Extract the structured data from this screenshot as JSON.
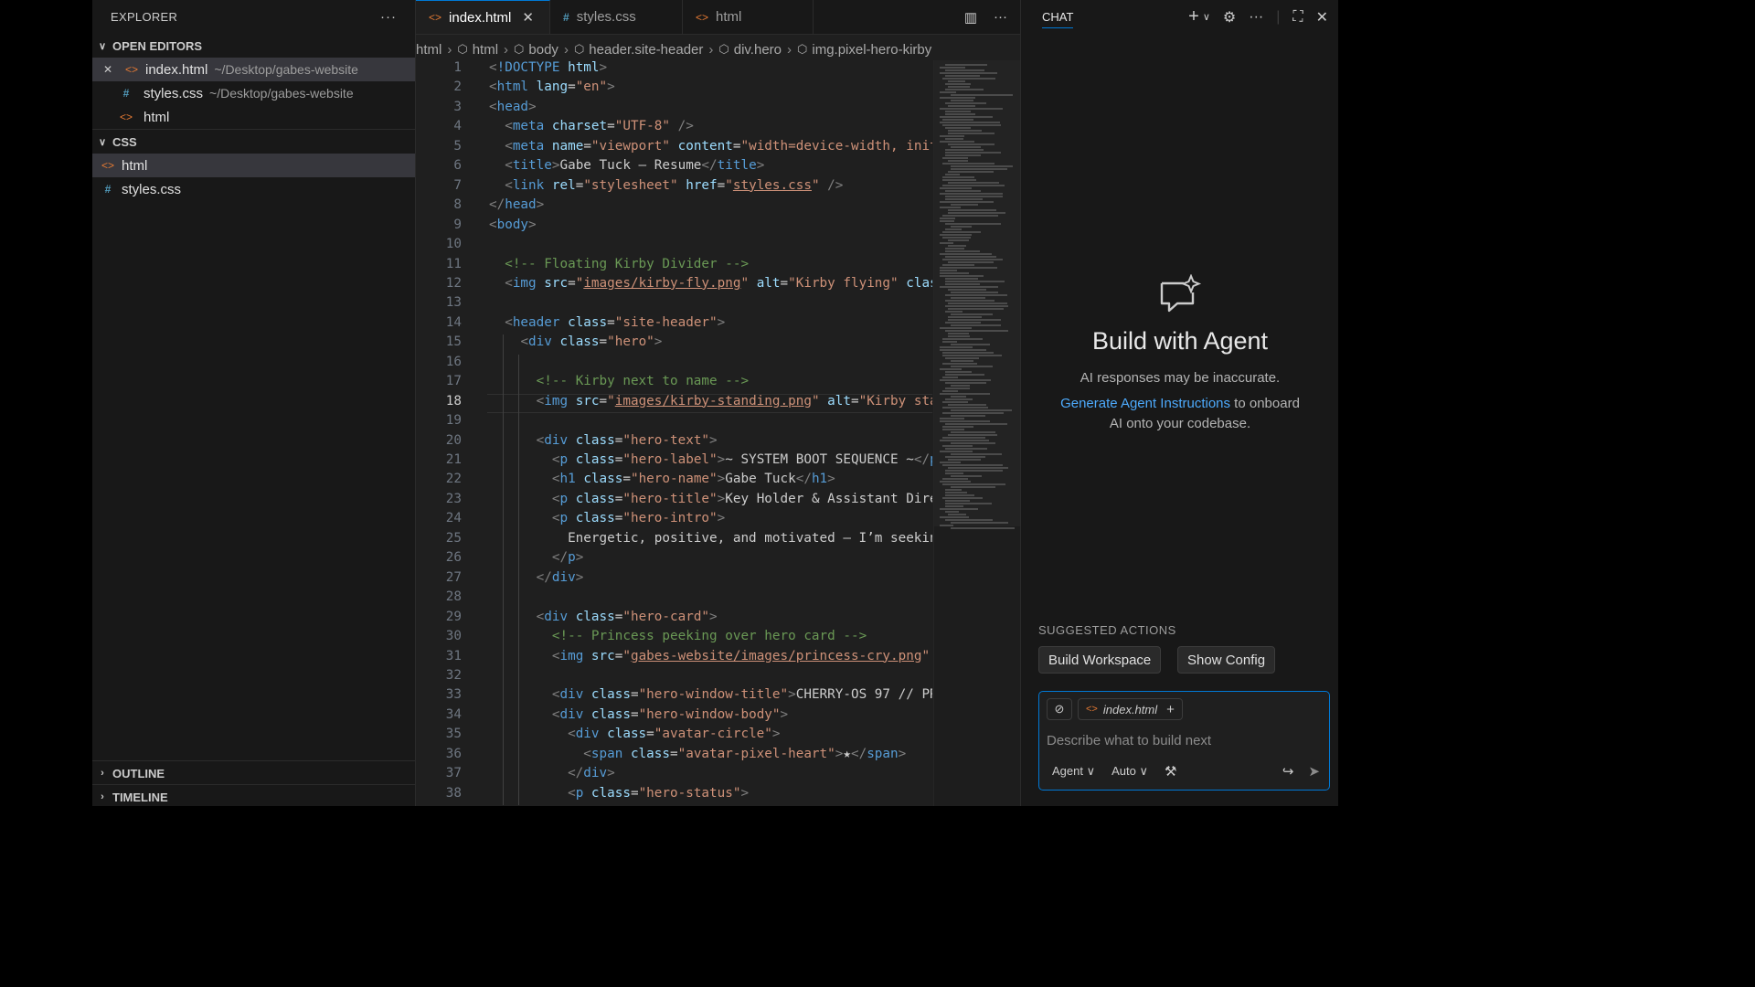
{
  "explorer": {
    "title": "EXPLORER",
    "more": "···",
    "open_editors": {
      "label": "OPEN EDITORS",
      "items": [
        {
          "name": "index.html",
          "path": "~/Desktop/gabes-website",
          "type": "html"
        },
        {
          "name": "styles.css",
          "path": "~/Desktop/gabes-website",
          "type": "css"
        },
        {
          "name": "html",
          "path": "",
          "type": "html"
        }
      ]
    },
    "folder": {
      "label": "CSS",
      "items": [
        {
          "name": "html",
          "type": "html"
        },
        {
          "name": "styles.css",
          "type": "css"
        }
      ]
    },
    "outline_label": "OUTLINE",
    "timeline_label": "TIMELINE"
  },
  "tabs": [
    {
      "label": "index.html",
      "type": "html",
      "active": true
    },
    {
      "label": "styles.css",
      "type": "css",
      "active": false
    },
    {
      "label": "html",
      "type": "html",
      "active": false
    }
  ],
  "breadcrumbs": [
    "html",
    "html",
    "body",
    "header.site-header",
    "div.hero",
    "img.pixel-hero-kirby"
  ],
  "editor": {
    "current_line": 18,
    "lines": [
      [
        [
          "p",
          "<"
        ],
        [
          "t",
          "!DOCTYPE"
        ],
        [
          "x",
          " "
        ],
        [
          "a",
          "html"
        ],
        [
          "p",
          ">"
        ]
      ],
      [
        [
          "p",
          "<"
        ],
        [
          "t",
          "html"
        ],
        [
          "x",
          " "
        ],
        [
          "a",
          "lang"
        ],
        [
          "x",
          "="
        ],
        [
          "s",
          "\"en\""
        ],
        [
          "p",
          ">"
        ]
      ],
      [
        [
          "p",
          "<"
        ],
        [
          "t",
          "head"
        ],
        [
          "p",
          ">"
        ]
      ],
      [
        [
          "x",
          "  "
        ],
        [
          "p",
          "<"
        ],
        [
          "t",
          "meta"
        ],
        [
          "x",
          " "
        ],
        [
          "a",
          "charset"
        ],
        [
          "x",
          "="
        ],
        [
          "s",
          "\"UTF-8\""
        ],
        [
          "x",
          " "
        ],
        [
          "p",
          "/>"
        ]
      ],
      [
        [
          "x",
          "  "
        ],
        [
          "p",
          "<"
        ],
        [
          "t",
          "meta"
        ],
        [
          "x",
          " "
        ],
        [
          "a",
          "name"
        ],
        [
          "x",
          "="
        ],
        [
          "s",
          "\"viewport\""
        ],
        [
          "x",
          " "
        ],
        [
          "a",
          "content"
        ],
        [
          "x",
          "="
        ],
        [
          "s",
          "\"width=device-width, init"
        ]
      ],
      [
        [
          "x",
          "  "
        ],
        [
          "p",
          "<"
        ],
        [
          "t",
          "title"
        ],
        [
          "p",
          ">"
        ],
        [
          "x",
          "Gabe Tuck – Resume"
        ],
        [
          "p",
          "</"
        ],
        [
          "t",
          "title"
        ],
        [
          "p",
          ">"
        ]
      ],
      [
        [
          "x",
          "  "
        ],
        [
          "p",
          "<"
        ],
        [
          "t",
          "link"
        ],
        [
          "x",
          " "
        ],
        [
          "a",
          "rel"
        ],
        [
          "x",
          "="
        ],
        [
          "s",
          "\"stylesheet\""
        ],
        [
          "x",
          " "
        ],
        [
          "a",
          "href"
        ],
        [
          "x",
          "="
        ],
        [
          "s",
          "\""
        ],
        [
          "u",
          "styles.css"
        ],
        [
          "s",
          "\""
        ],
        [
          "x",
          " "
        ],
        [
          "p",
          "/>"
        ]
      ],
      [
        [
          "p",
          "</"
        ],
        [
          "t",
          "head"
        ],
        [
          "p",
          ">"
        ]
      ],
      [
        [
          "p",
          "<"
        ],
        [
          "t",
          "body"
        ],
        [
          "p",
          ">"
        ]
      ],
      [],
      [
        [
          "x",
          "  "
        ],
        [
          "c",
          "<!-- Floating Kirby Divider -->"
        ]
      ],
      [
        [
          "x",
          "  "
        ],
        [
          "p",
          "<"
        ],
        [
          "t",
          "img"
        ],
        [
          "x",
          " "
        ],
        [
          "a",
          "src"
        ],
        [
          "x",
          "="
        ],
        [
          "s",
          "\""
        ],
        [
          "u",
          "images/kirby-fly.png"
        ],
        [
          "s",
          "\""
        ],
        [
          "x",
          " "
        ],
        [
          "a",
          "alt"
        ],
        [
          "x",
          "="
        ],
        [
          "s",
          "\"Kirby flying\""
        ],
        [
          "x",
          " "
        ],
        [
          "a",
          "clas"
        ]
      ],
      [],
      [
        [
          "x",
          "  "
        ],
        [
          "p",
          "<"
        ],
        [
          "t",
          "header"
        ],
        [
          "x",
          " "
        ],
        [
          "a",
          "class"
        ],
        [
          "x",
          "="
        ],
        [
          "s",
          "\"site-header\""
        ],
        [
          "p",
          ">"
        ]
      ],
      [
        [
          "x",
          "    "
        ],
        [
          "p",
          "<"
        ],
        [
          "t",
          "div"
        ],
        [
          "x",
          " "
        ],
        [
          "a",
          "class"
        ],
        [
          "x",
          "="
        ],
        [
          "s",
          "\"hero\""
        ],
        [
          "p",
          ">"
        ]
      ],
      [],
      [
        [
          "x",
          "      "
        ],
        [
          "c",
          "<!-- Kirby next to name -->"
        ]
      ],
      [
        [
          "x",
          "      "
        ],
        [
          "p",
          "<"
        ],
        [
          "t",
          "img"
        ],
        [
          "x",
          " "
        ],
        [
          "a",
          "src"
        ],
        [
          "x",
          "="
        ],
        [
          "s",
          "\""
        ],
        [
          "u",
          "images/kirby-standing.png"
        ],
        [
          "s",
          "\""
        ],
        [
          "x",
          " "
        ],
        [
          "a",
          "alt"
        ],
        [
          "x",
          "="
        ],
        [
          "s",
          "\"Kirby sta"
        ]
      ],
      [],
      [
        [
          "x",
          "      "
        ],
        [
          "p",
          "<"
        ],
        [
          "t",
          "div"
        ],
        [
          "x",
          " "
        ],
        [
          "a",
          "class"
        ],
        [
          "x",
          "="
        ],
        [
          "s",
          "\"hero-text\""
        ],
        [
          "p",
          ">"
        ]
      ],
      [
        [
          "x",
          "        "
        ],
        [
          "p",
          "<"
        ],
        [
          "t",
          "p"
        ],
        [
          "x",
          " "
        ],
        [
          "a",
          "class"
        ],
        [
          "x",
          "="
        ],
        [
          "s",
          "\"hero-label\""
        ],
        [
          "p",
          ">"
        ],
        [
          "x",
          "~ SYSTEM BOOT SEQUENCE ~"
        ],
        [
          "p",
          "</"
        ],
        [
          "t",
          "p"
        ]
      ],
      [
        [
          "x",
          "        "
        ],
        [
          "p",
          "<"
        ],
        [
          "t",
          "h1"
        ],
        [
          "x",
          " "
        ],
        [
          "a",
          "class"
        ],
        [
          "x",
          "="
        ],
        [
          "s",
          "\"hero-name\""
        ],
        [
          "p",
          ">"
        ],
        [
          "x",
          "Gabe Tuck"
        ],
        [
          "p",
          "</"
        ],
        [
          "t",
          "h1"
        ],
        [
          "p",
          ">"
        ]
      ],
      [
        [
          "x",
          "        "
        ],
        [
          "p",
          "<"
        ],
        [
          "t",
          "p"
        ],
        [
          "x",
          " "
        ],
        [
          "a",
          "class"
        ],
        [
          "x",
          "="
        ],
        [
          "s",
          "\"hero-title\""
        ],
        [
          "p",
          ">"
        ],
        [
          "x",
          "Key Holder & Assistant Dire"
        ]
      ],
      [
        [
          "x",
          "        "
        ],
        [
          "p",
          "<"
        ],
        [
          "t",
          "p"
        ],
        [
          "x",
          " "
        ],
        [
          "a",
          "class"
        ],
        [
          "x",
          "="
        ],
        [
          "s",
          "\"hero-intro\""
        ],
        [
          "p",
          ">"
        ]
      ],
      [
        [
          "x",
          "          Energetic, positive, and motivated – I’m seekin"
        ]
      ],
      [
        [
          "x",
          "        "
        ],
        [
          "p",
          "</"
        ],
        [
          "t",
          "p"
        ],
        [
          "p",
          ">"
        ]
      ],
      [
        [
          "x",
          "      "
        ],
        [
          "p",
          "</"
        ],
        [
          "t",
          "div"
        ],
        [
          "p",
          ">"
        ]
      ],
      [],
      [
        [
          "x",
          "      "
        ],
        [
          "p",
          "<"
        ],
        [
          "t",
          "div"
        ],
        [
          "x",
          " "
        ],
        [
          "a",
          "class"
        ],
        [
          "x",
          "="
        ],
        [
          "s",
          "\"hero-card\""
        ],
        [
          "p",
          ">"
        ]
      ],
      [
        [
          "x",
          "        "
        ],
        [
          "c",
          "<!-- Princess peeking over hero card -->"
        ]
      ],
      [
        [
          "x",
          "        "
        ],
        [
          "p",
          "<"
        ],
        [
          "t",
          "img"
        ],
        [
          "x",
          " "
        ],
        [
          "a",
          "src"
        ],
        [
          "x",
          "="
        ],
        [
          "s",
          "\""
        ],
        [
          "u",
          "gabes-website/images/princess-cry.png"
        ],
        [
          "s",
          "\""
        ]
      ],
      [],
      [
        [
          "x",
          "        "
        ],
        [
          "p",
          "<"
        ],
        [
          "t",
          "div"
        ],
        [
          "x",
          " "
        ],
        [
          "a",
          "class"
        ],
        [
          "x",
          "="
        ],
        [
          "s",
          "\"hero-window-title\""
        ],
        [
          "p",
          ">"
        ],
        [
          "x",
          "CHERRY-OS 97 // PR"
        ]
      ],
      [
        [
          "x",
          "        "
        ],
        [
          "p",
          "<"
        ],
        [
          "t",
          "div"
        ],
        [
          "x",
          " "
        ],
        [
          "a",
          "class"
        ],
        [
          "x",
          "="
        ],
        [
          "s",
          "\"hero-window-body\""
        ],
        [
          "p",
          ">"
        ]
      ],
      [
        [
          "x",
          "          "
        ],
        [
          "p",
          "<"
        ],
        [
          "t",
          "div"
        ],
        [
          "x",
          " "
        ],
        [
          "a",
          "class"
        ],
        [
          "x",
          "="
        ],
        [
          "s",
          "\"avatar-circle\""
        ],
        [
          "p",
          ">"
        ]
      ],
      [
        [
          "x",
          "            "
        ],
        [
          "p",
          "<"
        ],
        [
          "t",
          "span"
        ],
        [
          "x",
          " "
        ],
        [
          "a",
          "class"
        ],
        [
          "x",
          "="
        ],
        [
          "s",
          "\"avatar-pixel-heart\""
        ],
        [
          "p",
          ">"
        ],
        [
          "x",
          "★"
        ],
        [
          "p",
          "</"
        ],
        [
          "t",
          "span"
        ],
        [
          "p",
          ">"
        ]
      ],
      [
        [
          "x",
          "          "
        ],
        [
          "p",
          "</"
        ],
        [
          "t",
          "div"
        ],
        [
          "p",
          ">"
        ]
      ],
      [
        [
          "x",
          "          "
        ],
        [
          "p",
          "<"
        ],
        [
          "t",
          "p"
        ],
        [
          "x",
          " "
        ],
        [
          "a",
          "class"
        ],
        [
          "x",
          "="
        ],
        [
          "s",
          "\"hero-status\""
        ],
        [
          "p",
          ">"
        ]
      ]
    ]
  },
  "chat": {
    "title": "CHAT",
    "heading": "Build with Agent",
    "disclaimer": "AI responses may be inaccurate.",
    "link_text": "Generate Agent Instructions",
    "link_suffix": " to onboard",
    "line2": "AI onto your codebase.",
    "suggested_label": "SUGGESTED ACTIONS",
    "suggestions": [
      "Build Workspace",
      "Show Config"
    ],
    "context_file": "index.html",
    "placeholder": "Describe what to build next",
    "mode": "Agent",
    "model": "Auto"
  },
  "colors": {
    "accent": "#0078d4",
    "html_icon": "#e37933",
    "css_icon": "#519aba",
    "link": "#4daafc"
  }
}
